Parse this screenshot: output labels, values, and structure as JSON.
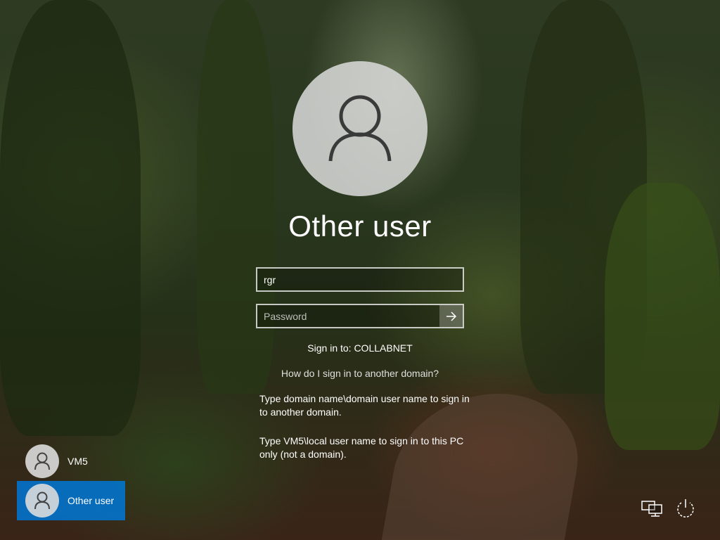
{
  "main": {
    "title": "Other user",
    "username_value": "rgr",
    "password_placeholder": "Password",
    "sign_in_to": "Sign in to: COLLABNET",
    "help_link": "How do I sign in to another domain?",
    "help_text_1": "Type domain name\\domain user name to sign in to another domain.",
    "help_text_2": "Type VM5\\local user name to sign in to this PC only (not a domain)."
  },
  "users": [
    {
      "name": "VM5",
      "selected": false
    },
    {
      "name": "Other user",
      "selected": true
    }
  ],
  "icons": {
    "avatar": "person-icon",
    "submit": "arrow-right-icon",
    "network": "network-icon",
    "power": "power-icon"
  },
  "colors": {
    "selected_tile": "#0078d7"
  }
}
